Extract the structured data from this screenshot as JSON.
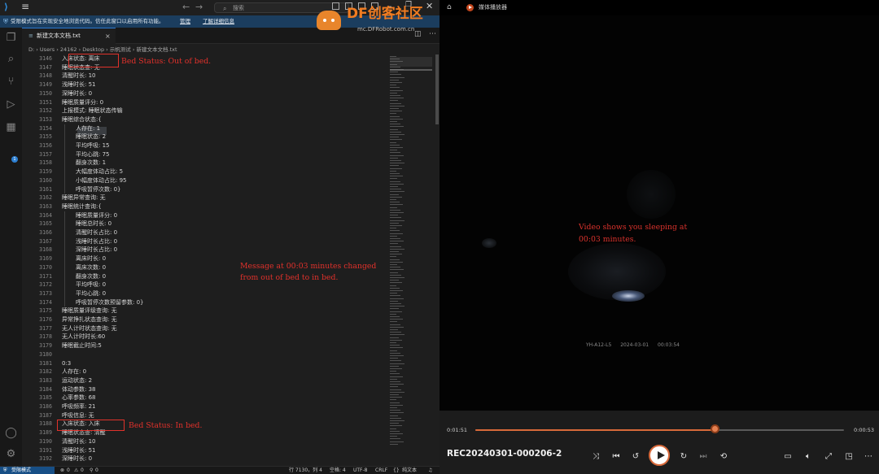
{
  "vscode": {
    "search_label": "搜索",
    "restricted": {
      "message": "受限模式旨在实现安全地浏览代码。信任此窗口以启用所有功能。",
      "manage": "管理",
      "learn_more": "了解详细信息"
    },
    "tab": {
      "label": "新建文本文档.txt"
    },
    "breadcrumb": "D: › Users › 24162 › Desktop › 示帆测试 › 新建文本文档.txt",
    "code_lines": [
      {
        "n": "3146",
        "t": "入床状态: 离床",
        "indent": 0
      },
      {
        "n": "3147",
        "t": "睡眠状态查: 无",
        "indent": 0
      },
      {
        "n": "3148",
        "t": "清醒时长: 10",
        "indent": 0
      },
      {
        "n": "3149",
        "t": "浅睡时长: 51",
        "indent": 0
      },
      {
        "n": "3150",
        "t": "深睡时长: 0",
        "indent": 0
      },
      {
        "n": "3151",
        "t": "睡眠质量评分: 0",
        "indent": 0
      },
      {
        "n": "3152",
        "t": "上报模式: 睡眠状态传输",
        "indent": 0
      },
      {
        "n": "3153",
        "t": "睡眠综合状态:{",
        "indent": 0
      },
      {
        "n": "3154",
        "t": "人存在: 1",
        "indent": 1
      },
      {
        "n": "3155",
        "t": "睡眠状态: 2",
        "indent": 1
      },
      {
        "n": "3156",
        "t": "平均呼吸: 15",
        "indent": 1
      },
      {
        "n": "3157",
        "t": "平均心跳: 75",
        "indent": 1
      },
      {
        "n": "3158",
        "t": "翻身次数: 1",
        "indent": 1
      },
      {
        "n": "3159",
        "t": "大幅度体动占比: 5",
        "indent": 1
      },
      {
        "n": "3160",
        "t": "小幅度体动占比: 95",
        "indent": 1
      },
      {
        "n": "3161",
        "t": "呼吸暂停次数: 0}",
        "indent": 1
      },
      {
        "n": "3162",
        "t": "睡眠异常查询: 无",
        "indent": 0
      },
      {
        "n": "3163",
        "t": "睡眠统计查询:{",
        "indent": 0
      },
      {
        "n": "3164",
        "t": "睡眠质量评分: 0",
        "indent": 1
      },
      {
        "n": "3165",
        "t": "睡眠总时长: 0",
        "indent": 1
      },
      {
        "n": "3166",
        "t": "清醒时长占比: 0",
        "indent": 1
      },
      {
        "n": "3167",
        "t": "浅睡时长占比: 0",
        "indent": 1
      },
      {
        "n": "3168",
        "t": "深睡时长占比: 0",
        "indent": 1
      },
      {
        "n": "3169",
        "t": "离床时长: 0",
        "indent": 1
      },
      {
        "n": "3170",
        "t": "离床次数: 0",
        "indent": 1
      },
      {
        "n": "3171",
        "t": "翻身次数: 0",
        "indent": 1
      },
      {
        "n": "3172",
        "t": "平均呼吸: 0",
        "indent": 1
      },
      {
        "n": "3173",
        "t": "平均心跳: 0",
        "indent": 1
      },
      {
        "n": "3174",
        "t": "呼吸暂停次数预留参数: 0}",
        "indent": 1
      },
      {
        "n": "3175",
        "t": "睡眠质量评级查询: 无",
        "indent": 0
      },
      {
        "n": "3176",
        "t": "异常挣扎状态查询: 无",
        "indent": 0
      },
      {
        "n": "3177",
        "t": "无人计时状态查询: 无",
        "indent": 0
      },
      {
        "n": "3178",
        "t": "无人计时时长:60",
        "indent": 0
      },
      {
        "n": "3179",
        "t": "睡眠截止时间:5",
        "indent": 0
      },
      {
        "n": "3180",
        "t": "",
        "indent": 0
      },
      {
        "n": "3181",
        "t": "0:3",
        "indent": 0
      },
      {
        "n": "3182",
        "t": "人存在: 0",
        "indent": 0
      },
      {
        "n": "3183",
        "t": "运动状态: 2",
        "indent": 0
      },
      {
        "n": "3184",
        "t": "体动参数: 38",
        "indent": 0
      },
      {
        "n": "3185",
        "t": "心率参数: 68",
        "indent": 0
      },
      {
        "n": "3186",
        "t": "呼吸频率: 21",
        "indent": 0
      },
      {
        "n": "3187",
        "t": "呼吸信息: 无",
        "indent": 0
      },
      {
        "n": "3188",
        "t": "入床状态: 入床",
        "indent": 0
      },
      {
        "n": "3189",
        "t": "睡眠状态查: 清醒",
        "indent": 0
      },
      {
        "n": "3190",
        "t": "清醒时长: 10",
        "indent": 0
      },
      {
        "n": "3191",
        "t": "浅睡时长: 51",
        "indent": 0
      },
      {
        "n": "3192",
        "t": "深睡时长: 0",
        "indent": 0
      }
    ],
    "annotations": {
      "top": "Bed Status: Out of bed.",
      "middle": "Message at 00:03 minutes changed from out of bed to in bed.",
      "bottom": "Bed Status: In bed."
    },
    "status": {
      "remote": "受限模式",
      "errors": "0",
      "warnings": "0",
      "ports": "0",
      "position": "行 7130，列 4",
      "spaces": "空格: 4",
      "encoding": "UTF-8",
      "eol": "CRLF",
      "language": "纯文本",
      "badge": "1"
    }
  },
  "player": {
    "app_name": "媒体播放器",
    "logo_text": "DF创客社区",
    "logo_url": "mc.DFRobot.com.cn",
    "video_caption": "Video shows you sleeping at 00:03 minutes.",
    "overlay": {
      "device": "YH-A12-L5",
      "date": "2024-03-01",
      "time": "00:03:54"
    },
    "elapsed": "0:01:51",
    "duration": "0:00:53",
    "progress": 0.65,
    "file_name": "REC20240301-000206-2"
  },
  "colors": {
    "accent": "#d86a3a",
    "annotation": "#e2312b",
    "vscode_blue": "#174f86"
  }
}
